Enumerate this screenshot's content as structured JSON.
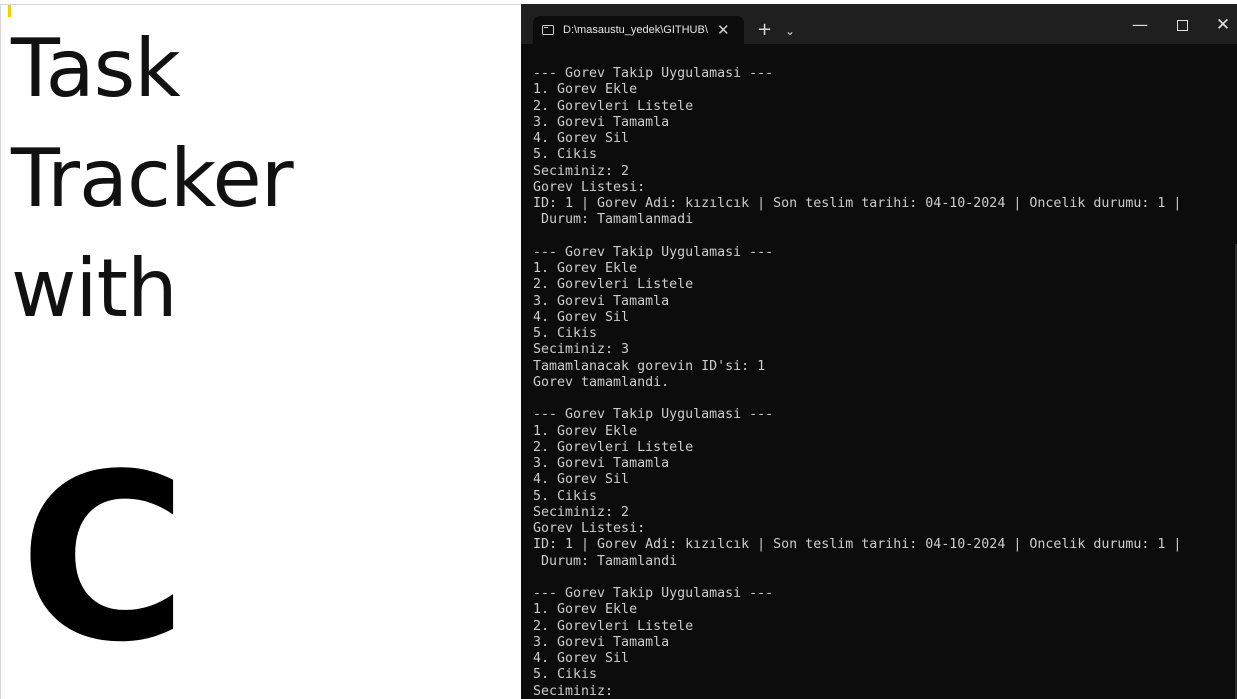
{
  "slide": {
    "title_lines": [
      "Task",
      "Tracker",
      "with"
    ],
    "big_letter": "C"
  },
  "terminal": {
    "tab_title": "D:\\masaustu_yedek\\GITHUB\\",
    "new_tab_label": "+",
    "dropdown_label": "⌄",
    "minimize_label": "—",
    "close_label": "✕",
    "close_tab_label": "✕",
    "lines": [
      "--- Gorev Takip Uygulamasi ---",
      "1. Gorev Ekle",
      "2. Gorevleri Listele",
      "3. Gorevi Tamamla",
      "4. Gorev Sil",
      "5. Cikis",
      "Seciminiz: 2",
      "Gorev Listesi:",
      "ID: 1 | Gorev Adi: kızılcık | Son teslim tarihi: 04-10-2024 | Oncelik durumu: 1 |",
      " Durum: Tamamlanmadi",
      "",
      "--- Gorev Takip Uygulamasi ---",
      "1. Gorev Ekle",
      "2. Gorevleri Listele",
      "3. Gorevi Tamamla",
      "4. Gorev Sil",
      "5. Cikis",
      "Seciminiz: 3",
      "Tamamlanacak gorevin ID'si: 1",
      "Gorev tamamlandi.",
      "",
      "--- Gorev Takip Uygulamasi ---",
      "1. Gorev Ekle",
      "2. Gorevleri Listele",
      "3. Gorevi Tamamla",
      "4. Gorev Sil",
      "5. Cikis",
      "Seciminiz: 2",
      "Gorev Listesi:",
      "ID: 1 | Gorev Adi: kızılcık | Son teslim tarihi: 04-10-2024 | Oncelik durumu: 1 |",
      " Durum: Tamamlandi",
      "",
      "--- Gorev Takip Uygulamasi ---",
      "1. Gorev Ekle",
      "2. Gorevleri Listele",
      "3. Gorevi Tamamla",
      "4. Gorev Sil",
      "5. Cikis",
      "Seciminiz:"
    ]
  },
  "colors": {
    "terminal_bg": "#0c0c0c",
    "titlebar_bg": "#1f1f1f",
    "console_text": "#cccccc",
    "cursor_mark": "#f2d000"
  }
}
